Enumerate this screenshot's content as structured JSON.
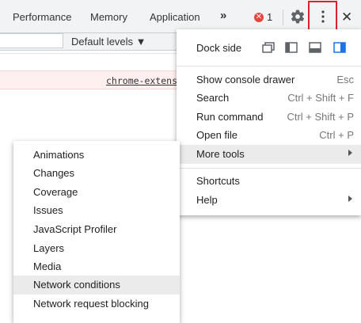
{
  "tabs": [
    "Performance",
    "Memory",
    "Application"
  ],
  "more_tabs_glyph": "»",
  "errors": {
    "icon": "error-icon",
    "count": "1"
  },
  "toolbar": {
    "levels_label": "Default levels ▼"
  },
  "console": {
    "error_link": "chrome-extens"
  },
  "main_menu": {
    "dock_side_label": "Dock side",
    "items": [
      {
        "label": "Show console drawer",
        "shortcut": "Esc"
      },
      {
        "label": "Search",
        "shortcut": "Ctrl + Shift + F"
      },
      {
        "label": "Run command",
        "shortcut": "Ctrl + Shift + P"
      },
      {
        "label": "Open file",
        "shortcut": "Ctrl + P"
      },
      {
        "label": "More tools",
        "shortcut": ""
      },
      {
        "label": "Shortcuts",
        "shortcut": ""
      },
      {
        "label": "Help",
        "shortcut": ""
      }
    ]
  },
  "more_tools_menu": {
    "items": [
      "Animations",
      "Changes",
      "Coverage",
      "Issues",
      "JavaScript Profiler",
      "Layers",
      "Media",
      "Network conditions",
      "Network request blocking"
    ]
  },
  "colors": {
    "highlight": "#e0202a",
    "accent": "#1a73e8",
    "error": "#e8453c"
  }
}
